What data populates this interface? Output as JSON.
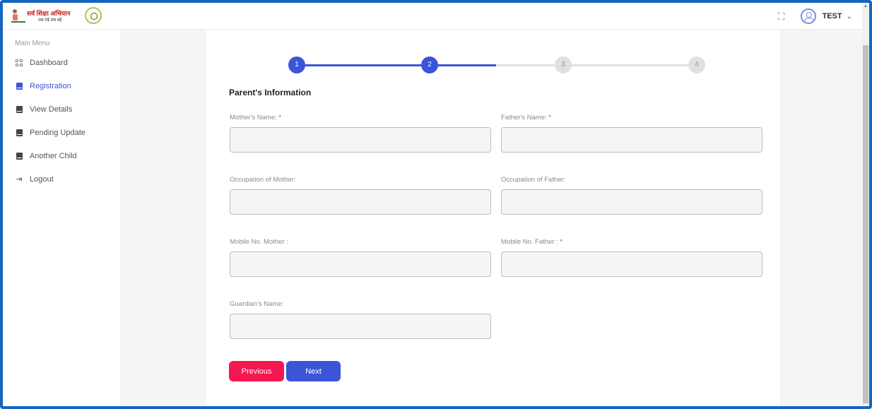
{
  "header": {
    "logo_text": "सर्व शिक्षा अभियान",
    "logo_sub": "सब पढ़ें सब बढ़ें",
    "user_name": "TEST"
  },
  "sidebar": {
    "menu_title": "Main Menu",
    "items": [
      {
        "label": "Dashboard",
        "icon": "grid-icon"
      },
      {
        "label": "Registration",
        "icon": "book-icon",
        "active": true
      },
      {
        "label": "View Details",
        "icon": "book-icon"
      },
      {
        "label": "Pending Update",
        "icon": "book-icon"
      },
      {
        "label": "Another Child",
        "icon": "book-icon"
      },
      {
        "label": "Logout",
        "icon": "logout-icon"
      }
    ]
  },
  "stepper": {
    "steps": [
      "1",
      "2",
      "3",
      "4"
    ],
    "current_step": 2
  },
  "form": {
    "title": "Parent's Information",
    "fields": {
      "mother_name": {
        "label": "Mother's Name:",
        "required": "*",
        "value": ""
      },
      "father_name": {
        "label": "Father's Name:",
        "required": "*",
        "value": ""
      },
      "occupation_mother": {
        "label": "Occupation of Mother:",
        "value": ""
      },
      "occupation_father": {
        "label": "Occupation of Father:",
        "value": ""
      },
      "mobile_mother": {
        "label": "Mobile No. Mother :",
        "value": ""
      },
      "mobile_father": {
        "label": "Mobile No. Father :",
        "required": "*",
        "value": ""
      },
      "guardian_name": {
        "label": "Guardian's Name:",
        "value": ""
      }
    },
    "previous_label": "Previous",
    "next_label": "Next"
  },
  "colors": {
    "primary": "#3b55d9",
    "danger": "#f5174f",
    "frame_border": "#1565c0"
  }
}
